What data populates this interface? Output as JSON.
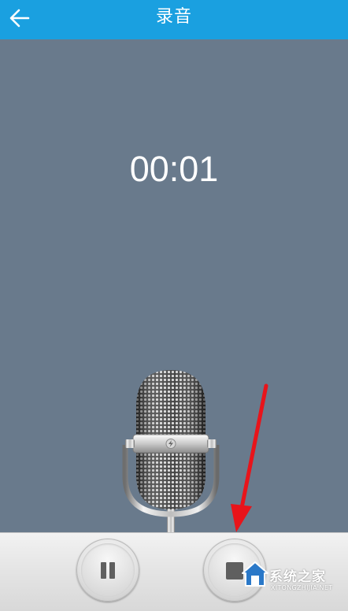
{
  "appbar": {
    "title": "录音",
    "back_icon": "arrow-left-icon",
    "color": "#1aa0e0"
  },
  "recorder": {
    "elapsed": "00:01",
    "background": "#697a8c",
    "mic_icon": "microphone-icon"
  },
  "controls": {
    "pause_icon": "pause-icon",
    "stop_icon": "stop-icon"
  },
  "annotation": {
    "icon": "red-arrow-icon",
    "color": "#e8141a"
  },
  "watermark": {
    "name": "系统之家",
    "site": "XITONGZHIJIA.NET"
  }
}
